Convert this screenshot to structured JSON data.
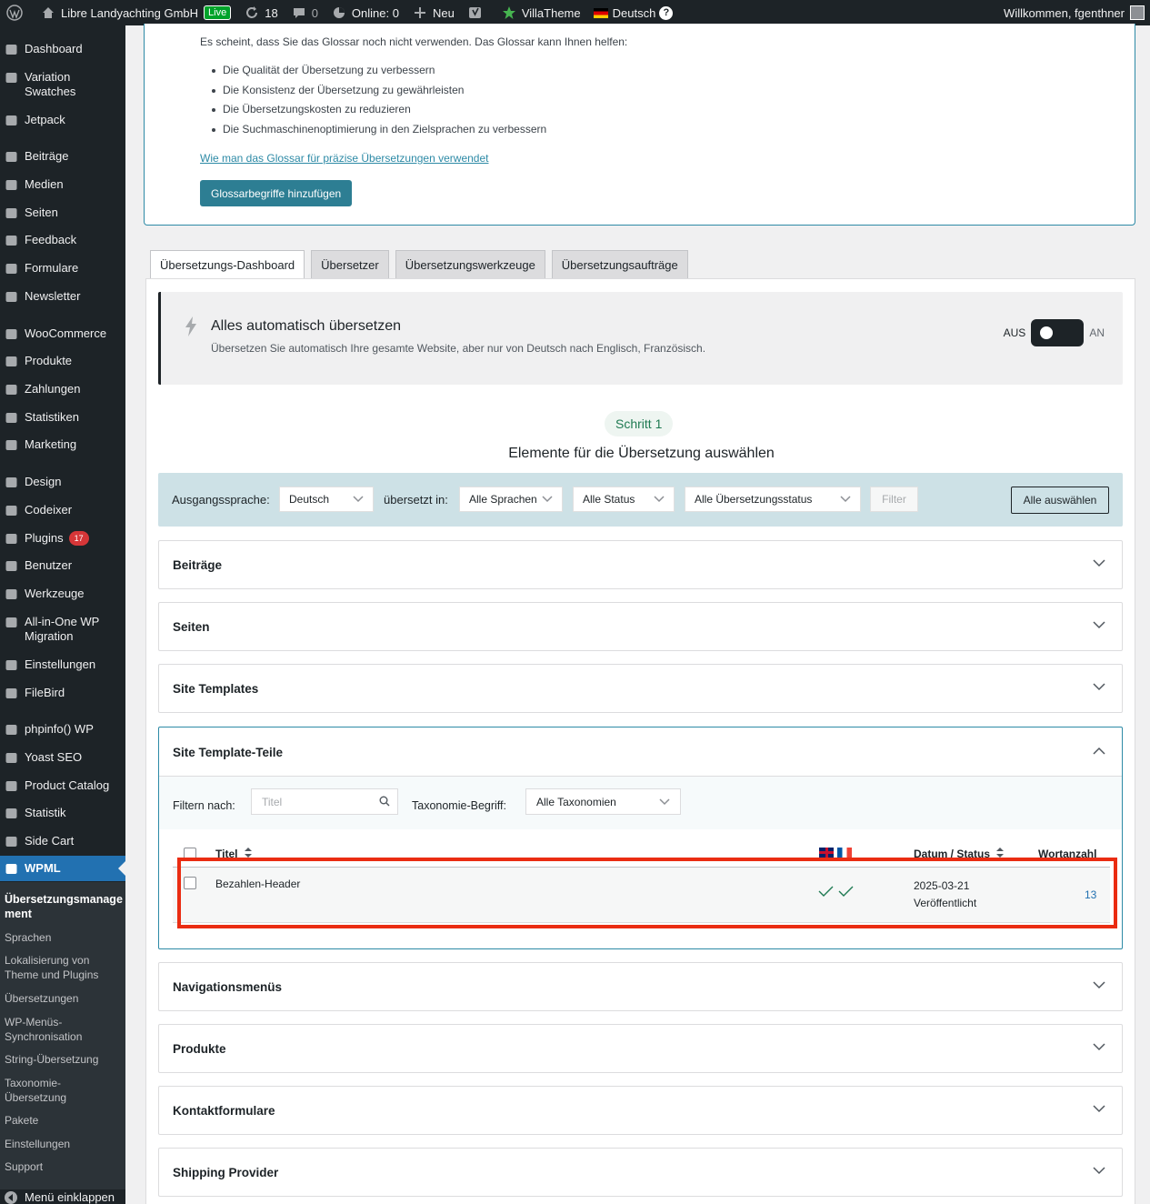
{
  "adminbar": {
    "site_name": "Libre Landyachting GmbH",
    "live_badge": "Live",
    "updates_count": "18",
    "comments_count": "0",
    "online": "Online: 0",
    "new_label": "Neu",
    "villatheme": "VillaTheme",
    "language": "Deutsch",
    "welcome": "Willkommen, fgenthner"
  },
  "sidebar": {
    "items": [
      {
        "label": "Dashboard",
        "icon": "dashboard-icon"
      },
      {
        "label": "Variation Swatches",
        "icon": "swatches-icon"
      },
      {
        "label": "Jetpack",
        "icon": "jetpack-icon"
      },
      {
        "label": "Beiträge",
        "icon": "pin-icon"
      },
      {
        "label": "Medien",
        "icon": "media-icon"
      },
      {
        "label": "Seiten",
        "icon": "page-icon"
      },
      {
        "label": "Feedback",
        "icon": "feedback-icon"
      },
      {
        "label": "Formulare",
        "icon": "mail-icon"
      },
      {
        "label": "Newsletter",
        "icon": "newsletter-icon"
      },
      {
        "label": "WooCommerce",
        "icon": "woo-icon"
      },
      {
        "label": "Produkte",
        "icon": "archive-icon"
      },
      {
        "label": "Zahlungen",
        "icon": "dollar-icon"
      },
      {
        "label": "Statistiken",
        "icon": "bar-chart-icon"
      },
      {
        "label": "Marketing",
        "icon": "megaphone-icon"
      },
      {
        "label": "Design",
        "icon": "brush-icon"
      },
      {
        "label": "Codeixer",
        "icon": "codeixer-icon"
      },
      {
        "label": "Plugins",
        "icon": "plug-icon",
        "badge": "17"
      },
      {
        "label": "Benutzer",
        "icon": "user-icon"
      },
      {
        "label": "Werkzeuge",
        "icon": "wrench-icon"
      },
      {
        "label": "All-in-One WP Migration",
        "icon": "migration-icon"
      },
      {
        "label": "Einstellungen",
        "icon": "settings-icon"
      },
      {
        "label": "FileBird",
        "icon": "folder-icon"
      },
      {
        "label": "phpinfo() WP",
        "icon": "php-icon"
      },
      {
        "label": "Yoast SEO",
        "icon": "yoast-icon"
      },
      {
        "label": "Product Catalog",
        "icon": "catalog-icon"
      },
      {
        "label": "Statistik",
        "icon": "pie-icon"
      },
      {
        "label": "Side Cart",
        "icon": "cart-icon"
      },
      {
        "label": "WPML",
        "icon": "wpml-icon"
      }
    ],
    "submenu": [
      "Übersetzungsmanagement",
      "Sprachen",
      "Lokalisierung von Theme und Plugins",
      "Übersetzungen",
      "WP-Menüs-Synchronisation",
      "String-Übersetzung",
      "Taxonomie-Übersetzung",
      "Pakete",
      "Einstellungen",
      "Support"
    ],
    "collapse": "Menü einklappen"
  },
  "glossary": {
    "intro": "Es scheint, dass Sie das Glossar noch nicht verwenden. Das Glossar kann Ihnen helfen:",
    "bullets": [
      "Die Qualität der Übersetzung zu verbessern",
      "Die Konsistenz der Übersetzung zu gewährleisten",
      "Die Übersetzungskosten zu reduzieren",
      "Die Suchmaschinenoptimierung in den Zielsprachen zu verbessern"
    ],
    "link": "Wie man das Glossar für präzise Übersetzungen verwendet",
    "button": "Glossarbegriffe hinzufügen"
  },
  "tabs": [
    "Übersetzungs-Dashboard",
    "Übersetzer",
    "Übersetzungswerkzeuge",
    "Übersetzungsaufträge"
  ],
  "auto": {
    "title": "Alles automatisch übersetzen",
    "subtitle": "Übersetzen Sie automatisch Ihre gesamte Website, aber nur von Deutsch nach Englisch, Französisch.",
    "off": "AUS",
    "on": "AN"
  },
  "step": {
    "pill": "Schritt 1",
    "title": "Elemente für die Übersetzung auswählen"
  },
  "filters": {
    "source_label": "Ausgangssprache:",
    "source_value": "Deutsch",
    "translated_label": "übersetzt in:",
    "languages": "Alle Sprachen",
    "status": "Alle Status",
    "translation_status": "Alle Übersetzungsstatus",
    "filter": "Filter",
    "select_all": "Alle auswählen"
  },
  "sections": {
    "s1": "Beiträge",
    "s2": "Seiten",
    "s3": "Site Templates",
    "open": "Site Template-Teile",
    "s5": "Navigationsmenüs",
    "s6": "Produkte",
    "s7": "Kontaktformulare",
    "s8": "Shipping Provider"
  },
  "subfilter": {
    "filter_label": "Filtern nach:",
    "title_placeholder": "Titel",
    "taxonomy_label": "Taxonomie-Begriff:",
    "taxonomy_value": "Alle Taxonomien"
  },
  "table": {
    "col_title": "Titel",
    "col_date": "Datum / Status",
    "col_words": "Wortanzahl",
    "row": {
      "title": "Bezahlen-Header",
      "date": "2025-03-21",
      "status": "Veröffentlicht",
      "words": "13"
    }
  },
  "colors": {
    "accent": "#2d8aa6",
    "wp_blue": "#2271b1",
    "highlight": "#ea2c12"
  }
}
